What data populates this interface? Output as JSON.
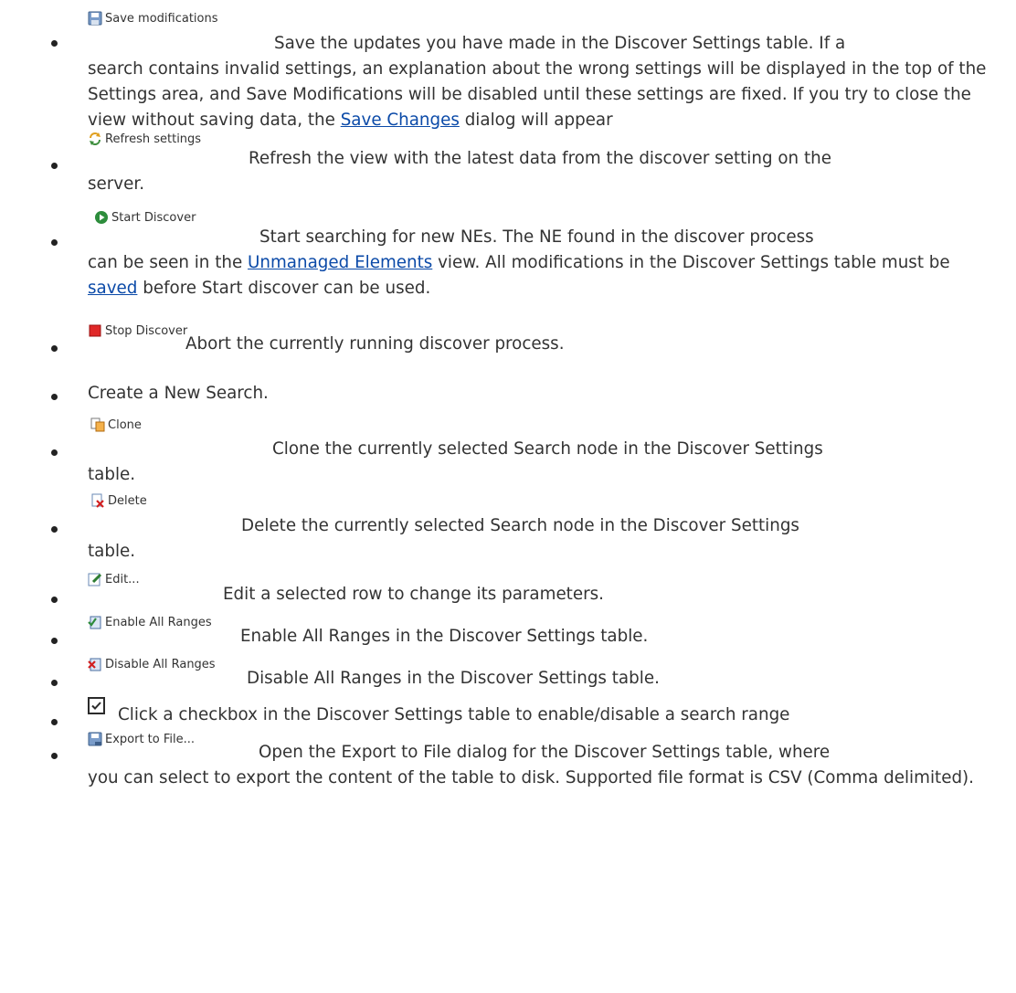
{
  "items": [
    {
      "button": {
        "label": "Save modifications",
        "icon": "save-icon"
      },
      "text_parts": {
        "a": "Save the updates you have made in the Discover Settings table. If a",
        "b": "search contains invalid settings, an explanation about the wrong settings will be displayed in the top of the Settings area, and Save Modifications will be disabled until these settings are fixed. If you try to close the view without saving data, the ",
        "link": "Save Changes",
        "c": " dialog will appear"
      }
    },
    {
      "button": {
        "label": "Refresh settings",
        "icon": "refresh-icon"
      },
      "text_parts": {
        "a": "Refresh the view with the latest data from the discover setting on the",
        "b": "server."
      }
    },
    {
      "button": {
        "label": "Start Discover",
        "icon": "start-discover-icon"
      },
      "text_parts": {
        "a": "Start searching for new NEs. The NE found in the discover process",
        "b": "can be seen in the ",
        "link": "Unmanaged Elements",
        "c": " view. All modifications in the Discover Settings table must be ",
        "link2": "saved",
        "d": " before Start discover can be used."
      }
    },
    {
      "button": {
        "label": "Stop Discover",
        "icon": "stop-discover-icon"
      },
      "text_parts": {
        "a": "Abort the currently running discover process."
      }
    },
    {
      "text_parts": {
        "a": "Create a New Search."
      }
    },
    {
      "button": {
        "label": "Clone",
        "icon": "clone-icon"
      },
      "text_parts": {
        "a": "Clone the currently selected Search node in the Discover Settings",
        "b": "table."
      }
    },
    {
      "button": {
        "label": "Delete",
        "icon": "delete-icon"
      },
      "text_parts": {
        "a": "Delete the currently selected Search node in the Discover Settings",
        "b": "table."
      }
    },
    {
      "button": {
        "label": "Edit...",
        "icon": "edit-icon"
      },
      "text_parts": {
        "a": "Edit a selected row to change its parameters."
      }
    },
    {
      "button": {
        "label": "Enable All Ranges",
        "icon": "enable-ranges-icon"
      },
      "text_parts": {
        "a": "Enable All Ranges in the Discover Settings table."
      }
    },
    {
      "button": {
        "label": "Disable All Ranges",
        "icon": "disable-ranges-icon"
      },
      "text_parts": {
        "a": "Disable All Ranges in the Discover Settings table."
      }
    },
    {
      "icon": "checkbox-icon",
      "text_parts": {
        "a": "Click a checkbox in the Discover Settings table to enable/disable a search range"
      }
    },
    {
      "button": {
        "label": "Export to File...",
        "icon": "export-icon"
      },
      "text_parts": {
        "a": "Open the Export to File dialog for the Discover Settings table, where",
        "b": "you can select to export the content of the table to disk. Supported file format is CSV (Comma delimited)."
      }
    }
  ],
  "colors": {
    "text": "#333333",
    "link": "#0b4aa8",
    "bullet": "#222222"
  }
}
